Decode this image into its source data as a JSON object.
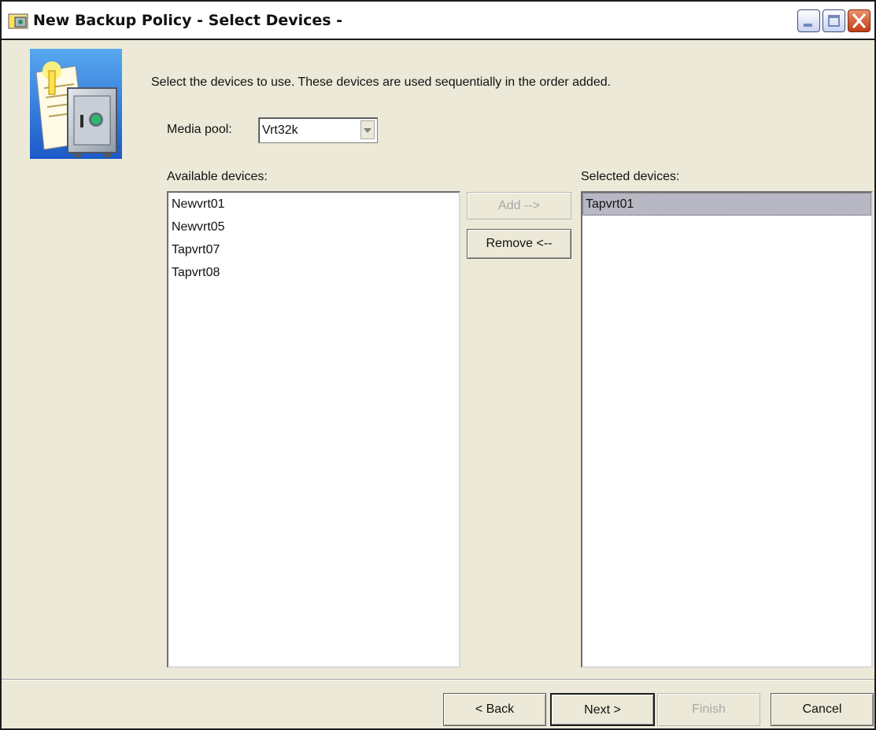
{
  "window": {
    "title": "New Backup Policy - Select Devices -",
    "controls": [
      "minimize-icon",
      "maximize-icon",
      "close-icon"
    ]
  },
  "wizard": {
    "icon": "vault-icon",
    "instructions": "Select the devices to use. These devices are used sequentially in the order added.",
    "media_pool": {
      "label": "Media pool:",
      "value": "Vrt32k"
    }
  },
  "available": {
    "label": "Available devices:",
    "items": [
      "Newvrt01",
      "Newvrt05",
      "Tapvrt07",
      "Tapvrt08"
    ]
  },
  "selected": {
    "label": "Selected devices:",
    "items": [
      "Tapvrt01"
    ],
    "highlighted": "Tapvrt01"
  },
  "buttons": {
    "add": "Add -->",
    "remove": "Remove <--",
    "back": "< Back",
    "next": "Next >",
    "finish": "Finish",
    "cancel": "Cancel"
  },
  "colors": {
    "dialog_bg": "#ece9d8",
    "selection_bg": "#b8b8c4",
    "close_button": "#c03c13"
  }
}
